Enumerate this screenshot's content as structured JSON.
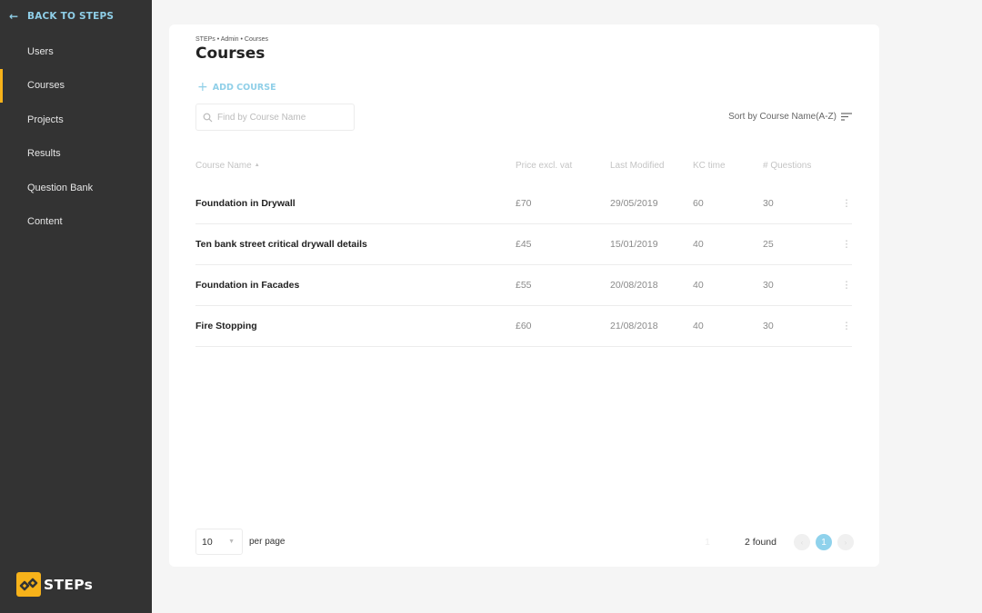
{
  "sidebar": {
    "back_label": "BACK TO STEPS",
    "back_icon": "arrow-left-icon",
    "items": [
      {
        "label": "Users",
        "active": false
      },
      {
        "label": "Courses",
        "active": true
      },
      {
        "label": "Projects",
        "active": false
      },
      {
        "label": "Results",
        "active": false
      },
      {
        "label": "Question Bank",
        "active": false
      },
      {
        "label": "Content",
        "active": false
      }
    ],
    "logo_text": "STEPs"
  },
  "header": {
    "breadcrumb": "STEPs • Admin • Courses",
    "title": "Courses",
    "add_label": "ADD COURSE"
  },
  "search": {
    "placeholder": "Find by Course Name",
    "value": ""
  },
  "sort": {
    "label": "Sort by Course Name(A-Z)"
  },
  "table": {
    "columns": [
      "Course Name",
      "Price excl. vat",
      "Last Modified",
      "KC time",
      "# Questions"
    ],
    "rows": [
      {
        "name": "Foundation in Drywall",
        "price": "£70",
        "modified": "29/05/2019",
        "kc": "60",
        "questions": "30"
      },
      {
        "name": "Ten bank street critical drywall details",
        "price": "£45",
        "modified": "15/01/2019",
        "kc": "40",
        "questions": "25"
      },
      {
        "name": "Foundation in Facades",
        "price": "£55",
        "modified": "20/08/2018",
        "kc": "40",
        "questions": "30"
      },
      {
        "name": "Fire Stopping",
        "price": "£60",
        "modified": "21/08/2018",
        "kc": "40",
        "questions": "30"
      }
    ]
  },
  "footer": {
    "per_page_value": "10",
    "per_page_label": "per page",
    "ghost_page": "1",
    "found_label": "2 found",
    "current_page": "1"
  },
  "colors": {
    "accent": "#8fcfe8",
    "active_indicator": "#f7b21a",
    "sidebar_bg": "#333333"
  }
}
